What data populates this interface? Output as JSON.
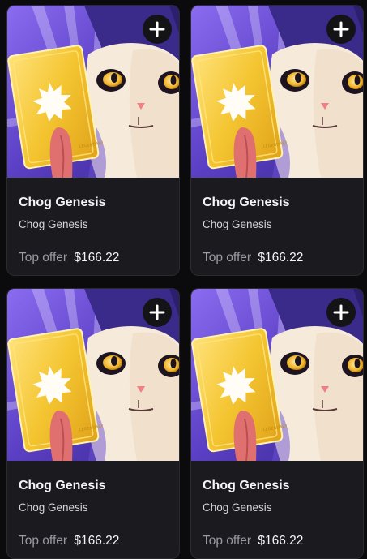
{
  "cards": [
    {
      "title": "Chog Genesis",
      "collection": "Chog Genesis",
      "offer_label": "Top offer",
      "offer_value": "$166.22",
      "add_icon": "plus-icon",
      "image": "chog-card-art"
    },
    {
      "title": "Chog Genesis",
      "collection": "Chog Genesis",
      "offer_label": "Top offer",
      "offer_value": "$166.22",
      "add_icon": "plus-icon",
      "image": "chog-card-art"
    },
    {
      "title": "Chog Genesis",
      "collection": "Chog Genesis",
      "offer_label": "Top offer",
      "offer_value": "$166.22",
      "add_icon": "plus-icon",
      "image": "chog-card-art"
    },
    {
      "title": "Chog Genesis",
      "collection": "Chog Genesis",
      "offer_label": "Top offer",
      "offer_value": "$166.22",
      "add_icon": "plus-icon",
      "image": "chog-card-art"
    }
  ],
  "colors": {
    "background": "#0b0b0d",
    "card": "#1b1b1f",
    "art_purple": "#6a4fd0",
    "card_gold": "#f2c230",
    "muted_text": "#9a9aa2"
  }
}
